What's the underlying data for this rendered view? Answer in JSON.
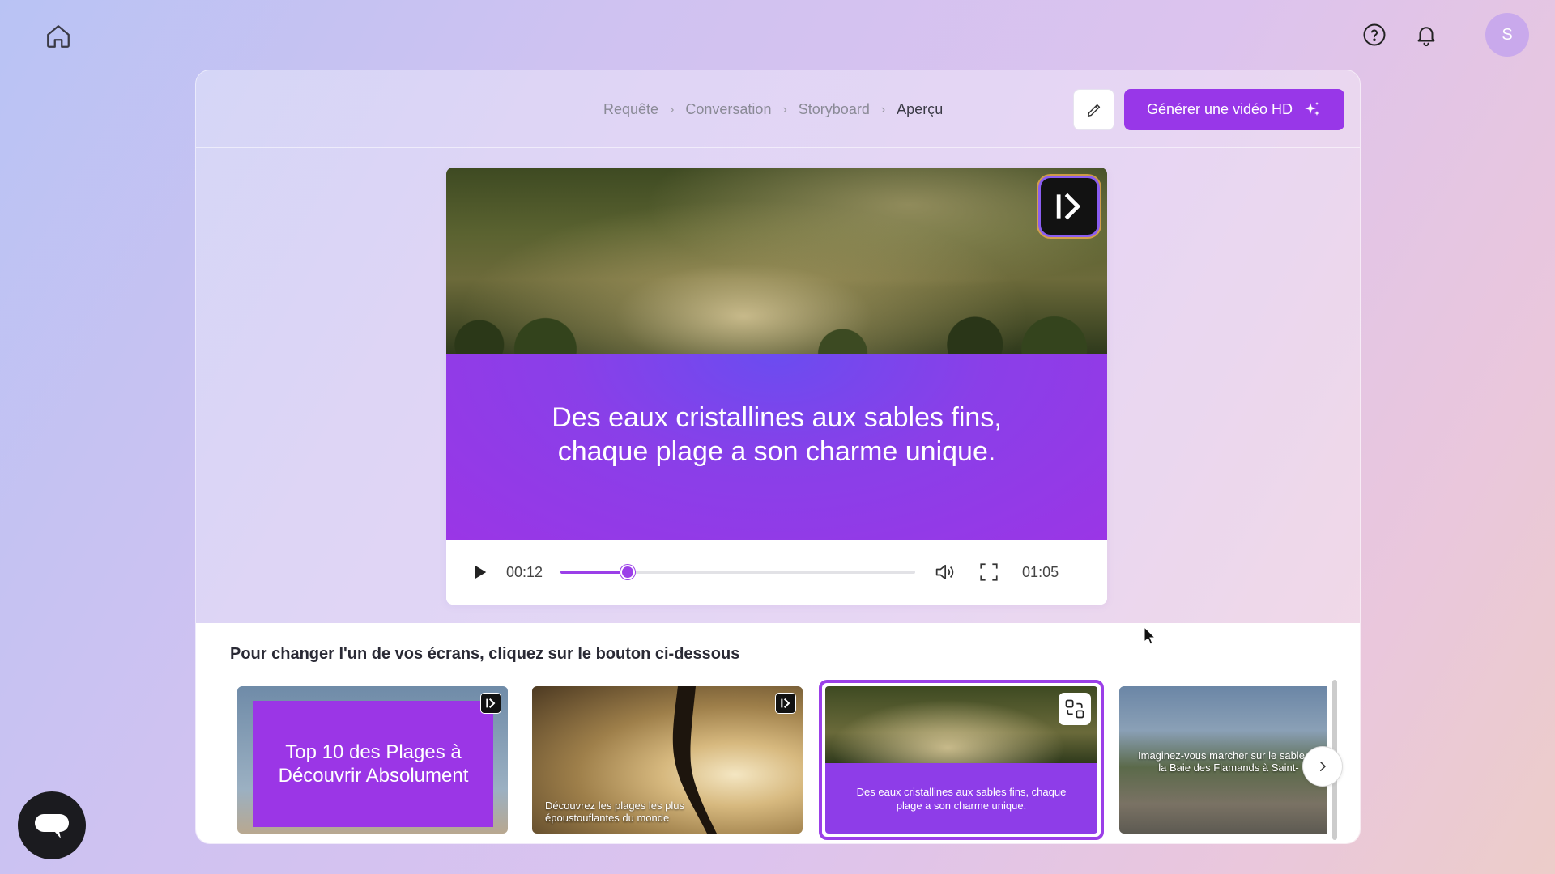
{
  "topbar": {
    "home_icon": "home-icon",
    "help_icon": "help-circle-icon",
    "bell_icon": "bell-icon",
    "avatar_initial": "S"
  },
  "breadcrumb": {
    "items": [
      "Requête",
      "Conversation",
      "Storyboard",
      "Aperçu"
    ],
    "active_index": 3
  },
  "header": {
    "edit_icon": "pencil-icon",
    "generate_label": "Générer une vidéo HD",
    "generate_icon": "sparkles-icon"
  },
  "player": {
    "caption": "Des eaux cristallines aux sables fins, chaque plage a son charme unique.",
    "current_time": "00:12",
    "total_time": "01:05",
    "progress": 0.19,
    "accent_color": "#9b3fe8"
  },
  "panel": {
    "title": "Pour changer l'un de vos écrans, cliquez sur le bouton ci-dessous",
    "thumbnails": [
      {
        "text": "Top 10 des Plages à Découvrir Absolument",
        "selected": false
      },
      {
        "text": "Découvrez les plages les plus époustouflantes du monde",
        "selected": false
      },
      {
        "text": "Des eaux cristallines aux sables fins, chaque plage a son charme unique.",
        "selected": true
      },
      {
        "text": "Imaginez-vous marcher sur le sable de la Baie des Flamands à Saint-",
        "selected": false
      }
    ]
  },
  "brand": {
    "primary": "#9837e8"
  }
}
